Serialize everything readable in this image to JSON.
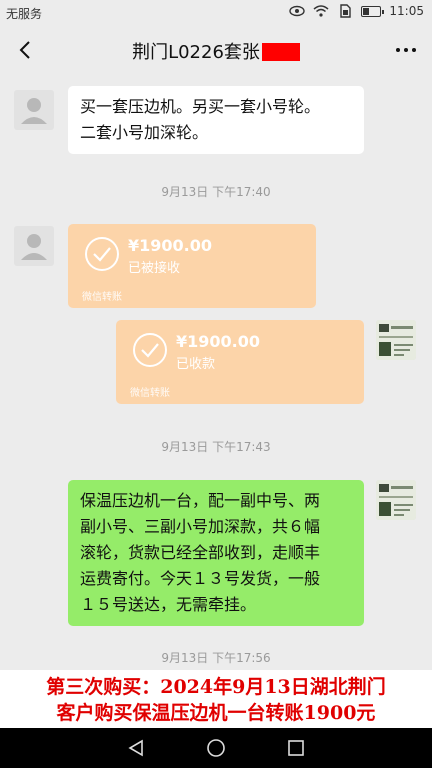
{
  "status_bar": {
    "carrier": "无服务",
    "time": "11:05",
    "battery_level": 0.4
  },
  "header": {
    "title": "荆门L0226套张"
  },
  "messages": [
    {
      "kind": "text",
      "side": "left",
      "text_lines": [
        "买一套压边机。另买一套小号轮。",
        "二套小号加深轮。"
      ]
    },
    {
      "kind": "timestamp",
      "text": "9月13日 下午17:40"
    },
    {
      "kind": "transfer",
      "side": "left",
      "amount": "¥1900.00",
      "status": "已被接收",
      "footer": "微信转账"
    },
    {
      "kind": "transfer",
      "side": "right",
      "amount": "¥1900.00",
      "status": "已收款",
      "footer": "微信转账"
    },
    {
      "kind": "timestamp",
      "text": "9月13日 下午17:43"
    },
    {
      "kind": "text",
      "side": "right",
      "text_lines": [
        "保温压边机一台，配一副中号、两",
        "副小号、三副小号加深款，共６幅",
        "滚轮，货款已经全部收到，走顺丰",
        "运费寄付。今天１３号发货，一般",
        "１５号送达，无需牵挂。"
      ]
    },
    {
      "kind": "timestamp",
      "text": "9月13日 下午17:56"
    }
  ],
  "caption": {
    "lines": [
      "第三次购买：2024年9月13日湖北荆门",
      "客户购买保温压边机一台转账1900元"
    ]
  },
  "colors": {
    "green_bubble": "#95ec69",
    "transfer_bubble": "#fcd4a9",
    "caption_text": "#e00000",
    "redaction": "#ff0000"
  }
}
